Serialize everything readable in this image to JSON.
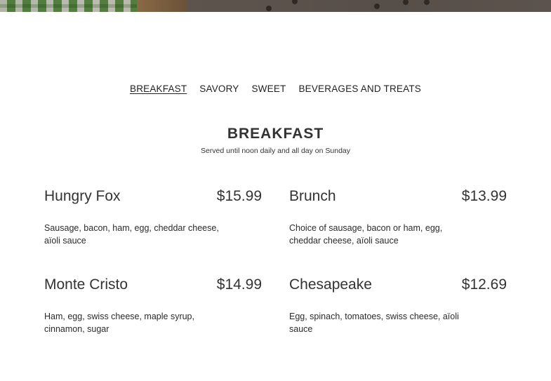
{
  "nav": {
    "items": [
      {
        "label": "BREAKFAST",
        "active": true
      },
      {
        "label": "SAVORY",
        "active": false
      },
      {
        "label": "SWEET",
        "active": false
      },
      {
        "label": "BEVERAGES AND TREATS",
        "active": false
      }
    ]
  },
  "section": {
    "title": "BREAKFAST",
    "subtitle": "Served until noon daily and all day on Sunday"
  },
  "menu": {
    "items": [
      {
        "name": "Hungry Fox",
        "price": "$15.99",
        "description": "Sausage, bacon, ham, egg, cheddar cheese, aïoli sauce"
      },
      {
        "name": "Brunch",
        "price": "$13.99",
        "description": "Choice of sausage, bacon or ham, egg, cheddar cheese, aïoli sauce"
      },
      {
        "name": "Monte Cristo",
        "price": "$14.99",
        "description": "Ham, egg, swiss cheese, maple syrup, cinnamon, sugar"
      },
      {
        "name": "Chesapeake",
        "price": "$12.69",
        "description": "Egg, spinach, tomatoes, swiss cheese, aïoli sauce"
      }
    ]
  }
}
